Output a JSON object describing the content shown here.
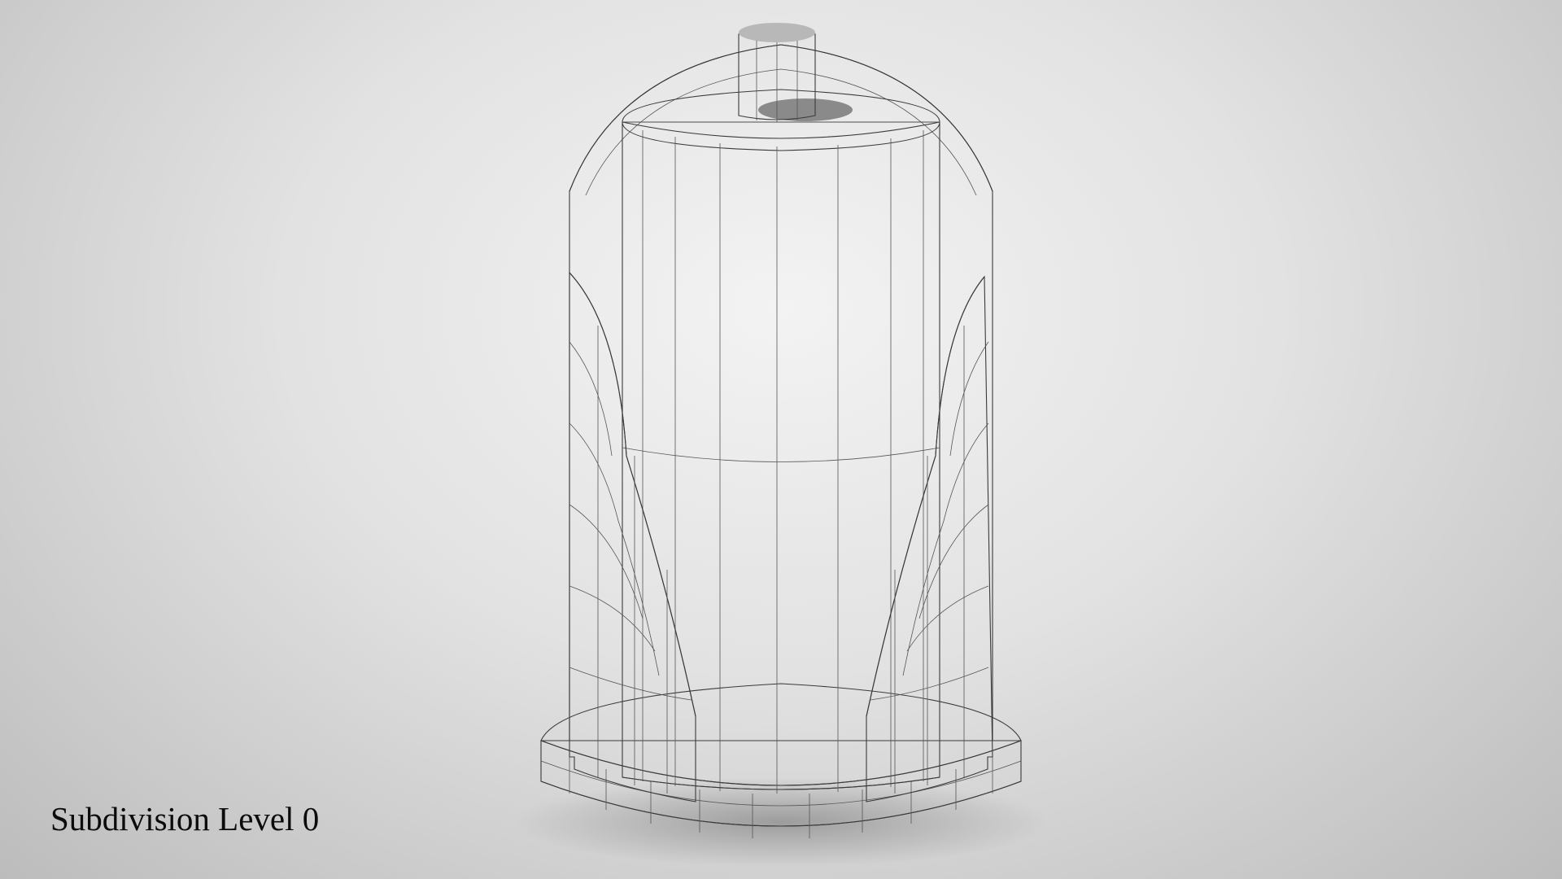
{
  "caption": "Subdivision Level 0",
  "viewport": {
    "background_center": "#f3f3f3",
    "background_edge": "#bdbcbc",
    "mesh_fill": "#9a9a9a",
    "wire_color": "#3a3a3a"
  },
  "model": {
    "object": "paper-towel-holder",
    "display": "wireframe-on-shaded"
  }
}
